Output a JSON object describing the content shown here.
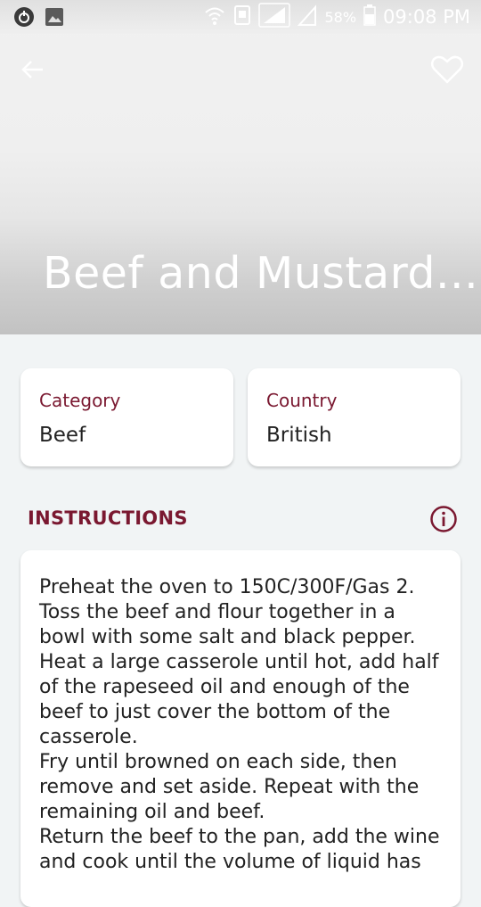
{
  "status_bar": {
    "battery": "58%",
    "time": "09:08 PM"
  },
  "header": {
    "title": "Beef and Mustard..."
  },
  "cards": {
    "category_label": "Category",
    "category_value": "Beef",
    "country_label": "Country",
    "country_value": "British"
  },
  "instructions": {
    "heading": "INSTRUCTIONS",
    "text": "Preheat the oven to 150C/300F/Gas 2.\nToss the beef and flour together in a bowl with some salt and black pepper.\nHeat a large casserole until hot, add half of the rapeseed oil and enough of the beef to just cover the bottom of the casserole.\nFry until browned on each side, then remove and set aside. Repeat with the remaining oil and beef.\nReturn the beef to the pan, add the wine and cook until the volume of liquid has"
  },
  "icons": {
    "back": "arrow-back-icon",
    "favorite": "heart-outline-icon",
    "info": "info-circle-icon"
  },
  "colors": {
    "accent": "#7a1830",
    "background": "#f1f4f5"
  }
}
